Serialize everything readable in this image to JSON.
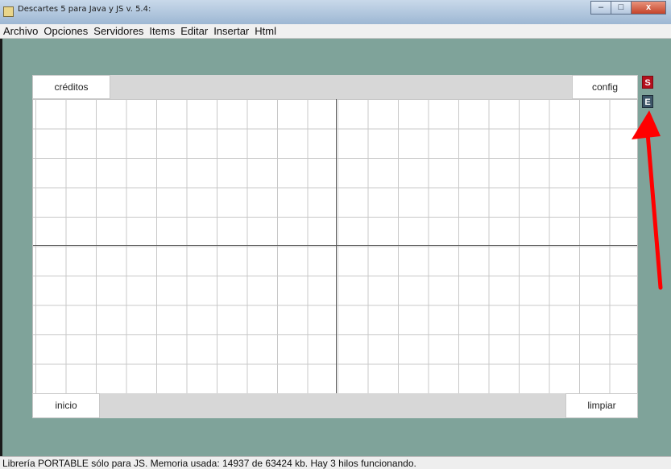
{
  "window": {
    "title": "Descartes 5 para Java y JS v. 5.4:",
    "minimize_glyph": "–",
    "maximize_glyph": "□",
    "close_glyph": "x"
  },
  "menu": [
    "Archivo",
    "Opciones",
    "Servidores",
    "Items",
    "Editar",
    "Insertar",
    "Html"
  ],
  "scene": {
    "creditos_label": "créditos",
    "config_label": "config",
    "inicio_label": "inicio",
    "limpiar_label": "limpiar"
  },
  "side_buttons": {
    "s_label": "S",
    "e_label": "E"
  },
  "annotation": {
    "arrow_color": "#ff0000"
  },
  "status": "Librería PORTABLE sólo para JS. Memoria usada: 14937 de 63424 kb. Hay 3 hilos funcionando.",
  "icons": [
    "app-icon",
    "minimize-icon",
    "maximize-icon",
    "close-icon"
  ]
}
